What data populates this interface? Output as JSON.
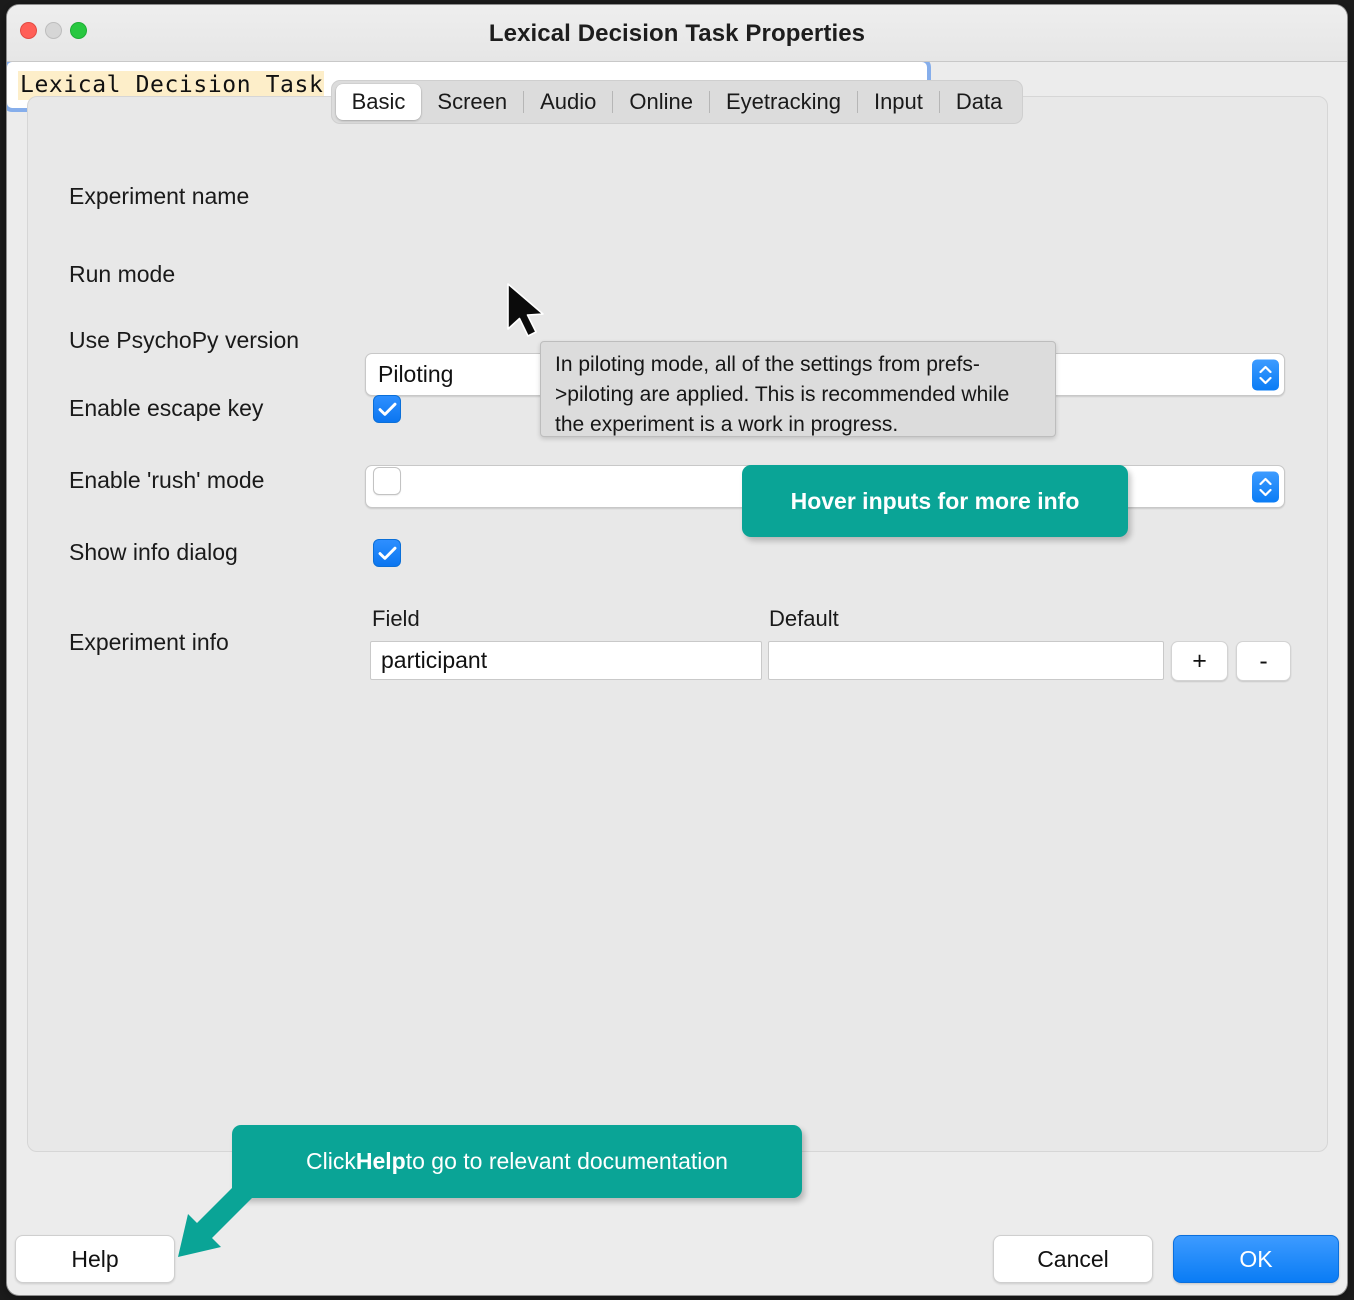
{
  "window": {
    "title": "Lexical Decision Task Properties",
    "traffic_lights": [
      "close",
      "minimize",
      "zoom"
    ]
  },
  "tabs": [
    {
      "label": "Basic",
      "active": true
    },
    {
      "label": "Screen",
      "active": false
    },
    {
      "label": "Audio",
      "active": false
    },
    {
      "label": "Online",
      "active": false
    },
    {
      "label": "Eyetracking",
      "active": false
    },
    {
      "label": "Input",
      "active": false
    },
    {
      "label": "Data",
      "active": false
    }
  ],
  "form": {
    "experiment_name": {
      "label": "Experiment name",
      "value": "Lexical Decision Task"
    },
    "run_mode": {
      "label": "Run mode",
      "value": "Piloting"
    },
    "psychopy_version": {
      "label": "Use PsychoPy version",
      "value": ""
    },
    "enable_escape_key": {
      "label": "Enable escape key",
      "checked": true
    },
    "enable_rush_mode": {
      "label": "Enable 'rush' mode",
      "checked": false
    },
    "show_info_dialog": {
      "label": "Show info dialog",
      "checked": true
    },
    "experiment_info": {
      "label": "Experiment info",
      "columns": [
        "Field",
        "Default"
      ],
      "rows": [
        {
          "field": "participant",
          "default": ""
        }
      ],
      "add_label": "+",
      "remove_label": "-"
    }
  },
  "tooltip": {
    "text": "In piloting mode, all of the settings from prefs->piloting are applied. This is recommended while the experiment is a work in progress."
  },
  "callouts": {
    "hover": {
      "text": "Hover inputs for more info"
    },
    "help": {
      "prefix": "Click ",
      "bold": "Help",
      "suffix": " to go to relevant documentation"
    }
  },
  "buttons": {
    "help": "Help",
    "cancel": "Cancel",
    "ok": "OK"
  },
  "colors": {
    "accent_teal": "#0aa496",
    "accent_blue": "#0a7cf5",
    "highlight_yellow": "#fdeec9",
    "window_bg": "#ececec",
    "panel_bg": "#e8e8e8"
  }
}
